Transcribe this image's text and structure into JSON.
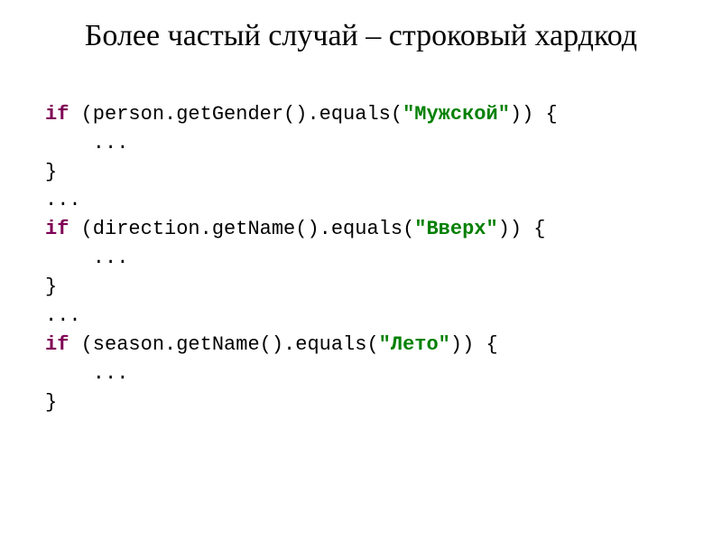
{
  "title": "Более частый случай – строковый хардкод",
  "code": {
    "kw_if_1": "if",
    "line1_a": " (person.getGender().equals(",
    "str1": "\"Мужской\"",
    "line1_b": ")) {",
    "line2": "    ...",
    "line3": "}",
    "line4": "...",
    "kw_if_2": "if",
    "line5_a": " (direction.getName().equals(",
    "str2": "\"Вверх\"",
    "line5_b": ")) {",
    "line6": "    ...",
    "line7": "}",
    "line8": "...",
    "kw_if_3": "if",
    "line9_a": " (season.getName().equals(",
    "str3": "\"Лето\"",
    "line9_b": ")) {",
    "line10": "    ...",
    "line11": "}"
  }
}
